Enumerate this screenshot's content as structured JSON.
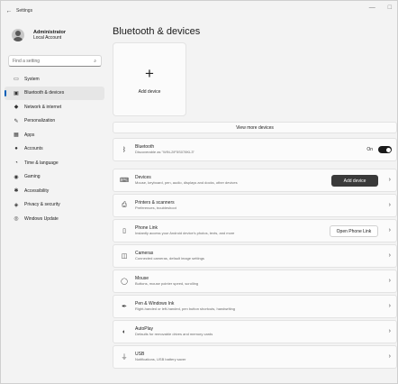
{
  "window": {
    "title": "Settings",
    "back": "←",
    "min": "—",
    "max": "□"
  },
  "profile": {
    "name": "Administrator",
    "account": "Local Account"
  },
  "search": {
    "placeholder": "Find a setting",
    "icon": "⌕"
  },
  "nav": [
    {
      "label": "System",
      "icon": "▭"
    },
    {
      "label": "Bluetooth & devices",
      "icon": "▣",
      "active": true
    },
    {
      "label": "Network & internet",
      "icon": "◆"
    },
    {
      "label": "Personalization",
      "icon": "✎"
    },
    {
      "label": "Apps",
      "icon": "▦"
    },
    {
      "label": "Accounts",
      "icon": "●"
    },
    {
      "label": "Time & language",
      "icon": "◔"
    },
    {
      "label": "Gaming",
      "icon": "◉"
    },
    {
      "label": "Accessibility",
      "icon": "✱"
    },
    {
      "label": "Privacy & security",
      "icon": "◈"
    },
    {
      "label": "Windows Update",
      "icon": "◎"
    }
  ],
  "main": {
    "title": "Bluetooth & devices",
    "add_device": "Add device",
    "add_plus": "+",
    "view_more": "View more devices",
    "bluetooth": {
      "title": "Bluetooth",
      "subtitle": "Discoverable as \"WIN-2IF5S078KL3\"",
      "state": "On",
      "icon": "ᛒ"
    },
    "cards": [
      {
        "title": "Devices",
        "subtitle": "Mouse, keyboard, pen, audio, displays and docks, other devices",
        "icon": "⌨",
        "button": "Add device"
      },
      {
        "title": "Printers & scanners",
        "subtitle": "Preferences, troubleshoot",
        "icon": "⎙"
      },
      {
        "title": "Phone Link",
        "subtitle": "Instantly access your Android device's photos, texts, and more",
        "icon": "▯",
        "button": "Open Phone Link"
      },
      {
        "title": "Cameras",
        "subtitle": "Connected cameras, default image settings",
        "icon": "◫"
      },
      {
        "title": "Mouse",
        "subtitle": "Buttons, mouse pointer speed, scrolling",
        "icon": "◯"
      },
      {
        "title": "Pen & Windows Ink",
        "subtitle": "Right-handed or left-handed, pen button shortcuts, handwriting",
        "icon": "✒"
      },
      {
        "title": "AutoPlay",
        "subtitle": "Defaults for removable drives and memory cards",
        "icon": "◐"
      },
      {
        "title": "USB",
        "subtitle": "Notifications, USB battery saver",
        "icon": "⏚"
      }
    ],
    "chevron": "›"
  }
}
